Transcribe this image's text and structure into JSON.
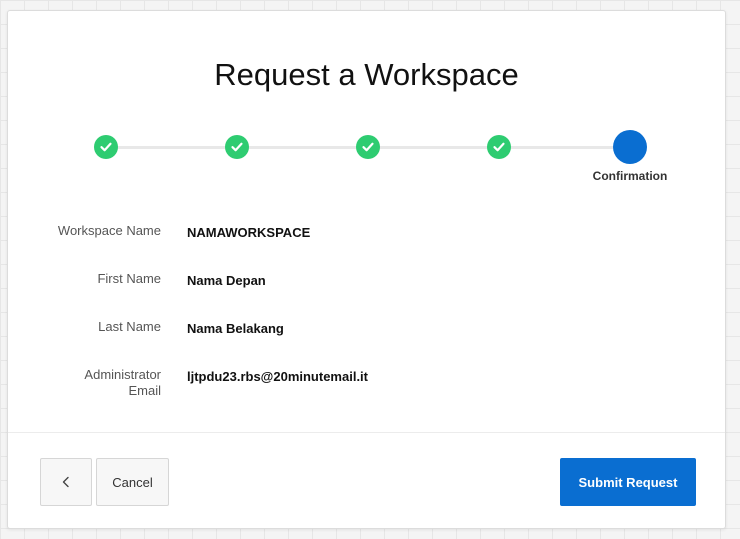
{
  "dialog": {
    "title": "Request a Workspace"
  },
  "wizard": {
    "steps": [
      {
        "status": "complete",
        "icon": "check-icon"
      },
      {
        "status": "complete",
        "icon": "check-icon"
      },
      {
        "status": "complete",
        "icon": "check-icon"
      },
      {
        "status": "complete",
        "icon": "check-icon"
      },
      {
        "status": "current",
        "label": "Confirmation"
      }
    ],
    "complete_color": "#2ecc71",
    "current_color": "#0a6ed1"
  },
  "fields": {
    "workspace_name": {
      "label": "Workspace Name",
      "value": "NAMAWORKSPACE"
    },
    "first_name": {
      "label": "First Name",
      "value": "Nama Depan"
    },
    "last_name": {
      "label": "Last Name",
      "value": "Nama Belakang"
    },
    "admin_email": {
      "label": "Administrator Email",
      "value": "ljtpdu23.rbs@20minutemail.it"
    }
  },
  "footer": {
    "back_icon": "chevron-left-icon",
    "cancel_label": "Cancel",
    "submit_label": "Submit Request",
    "submit_color": "#0a6ed1"
  }
}
